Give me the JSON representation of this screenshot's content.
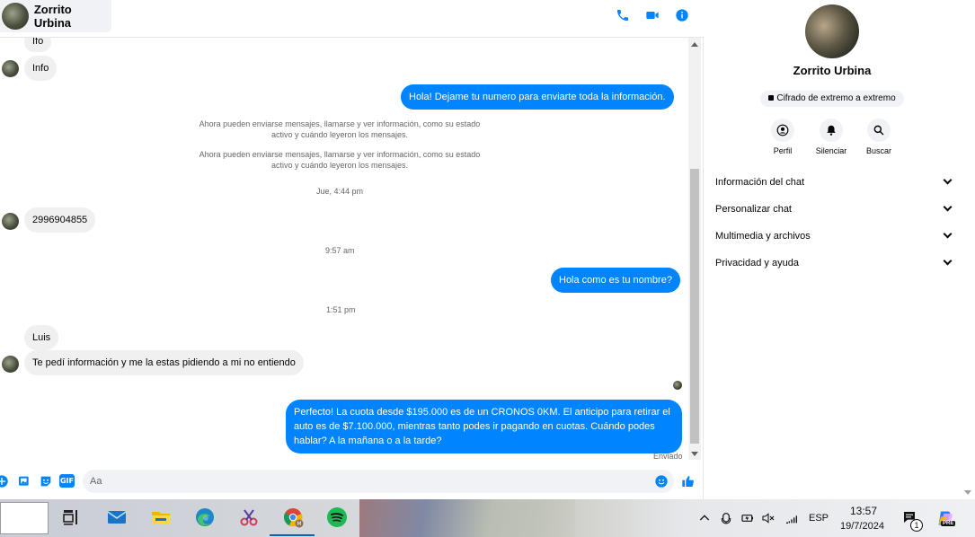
{
  "header": {
    "contact_name": "Zorrito Urbina",
    "icons": [
      "phone-icon",
      "video-icon",
      "info-icon"
    ]
  },
  "messages": {
    "m_ifo": "Ifo",
    "m_info": "Info",
    "m_hola1": "Hola! Dejame tu numero  para enviarte toda la información.",
    "sys1": "Ahora pueden enviarse mensajes, llamarse y ver información, como su estado activo y cuándo leyeron los mensajes.",
    "sys2": "Ahora pueden enviarse mensajes, llamarse y ver información, como su estado activo y cuándo leyeron los mensajes.",
    "ts1": "Jue, 4:44 pm",
    "m_phone": "2996904855",
    "ts2": "9:57 am",
    "m_hola2": "Hola como es tu nombre?",
    "ts3": "1:51 pm",
    "m_luis": "Luis",
    "m_tepedi": "Te pedí información y me la estas pidiendo a mi no entiendo",
    "m_perfecto": "Perfecto! La cuota desde $195.000 es de un CRONOS 0KM. El anticipo para retirar el auto es de $7.100.000, mientras tanto podes ir pagando en cuotas. Cuándo podes hablar? A la mañana o a la tarde?",
    "status": "Enviado"
  },
  "composer": {
    "placeholder": "Aa",
    "gif_label": "GIF"
  },
  "panel": {
    "name": "Zorrito Urbina",
    "e2e": "Cifrado de extremo a extremo",
    "actions": {
      "profile": "Perfil",
      "mute": "Silenciar",
      "search": "Buscar"
    },
    "sections": [
      "Información del chat",
      "Personalizar chat",
      "Multimedia y archivos",
      "Privacidad y ayuda"
    ]
  },
  "taskbar": {
    "apps": [
      "task-view-icon",
      "mail-icon",
      "file-explorer-icon",
      "edge-icon",
      "snipping-tool-icon",
      "chrome-icon",
      "spotify-icon"
    ],
    "language": "ESP",
    "time": "13:57",
    "date": "19/7/2024",
    "notification_count": "1",
    "copilot_badge": "PRE"
  },
  "colors": {
    "accent": "#0084ff",
    "incoming_bubble": "#f0f0f0",
    "secondary_text": "#65676b"
  }
}
